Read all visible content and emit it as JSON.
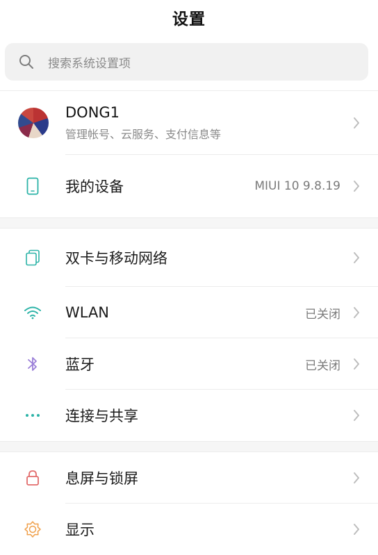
{
  "header": {
    "title": "设置"
  },
  "search": {
    "placeholder": "搜索系统设置项",
    "icon": "search-icon"
  },
  "profile": {
    "name": "DONG1",
    "subtitle": "管理帐号、云服务、支付信息等"
  },
  "groups": [
    {
      "items": [
        {
          "label": "我的设备",
          "value": "MIUI 10 9.8.19",
          "icon": "phone-icon"
        }
      ]
    },
    {
      "items": [
        {
          "label": "双卡与移动网络",
          "value": "",
          "icon": "sim-card-icon"
        },
        {
          "label": "WLAN",
          "value": "已关闭",
          "icon": "wifi-icon"
        },
        {
          "label": "蓝牙",
          "value": "已关闭",
          "icon": "bluetooth-icon"
        },
        {
          "label": "连接与共享",
          "value": "",
          "icon": "more-dots-icon"
        }
      ]
    },
    {
      "items": [
        {
          "label": "息屏与锁屏",
          "value": "",
          "icon": "lock-icon"
        },
        {
          "label": "显示",
          "value": "",
          "icon": "sun-icon"
        }
      ]
    }
  ],
  "colors": {
    "teal": "#2bb3a7",
    "bluetooth": "#9b7fd8",
    "red": "#e26b6b",
    "orange": "#f0a04b",
    "chevron": "#bdbdbd"
  }
}
